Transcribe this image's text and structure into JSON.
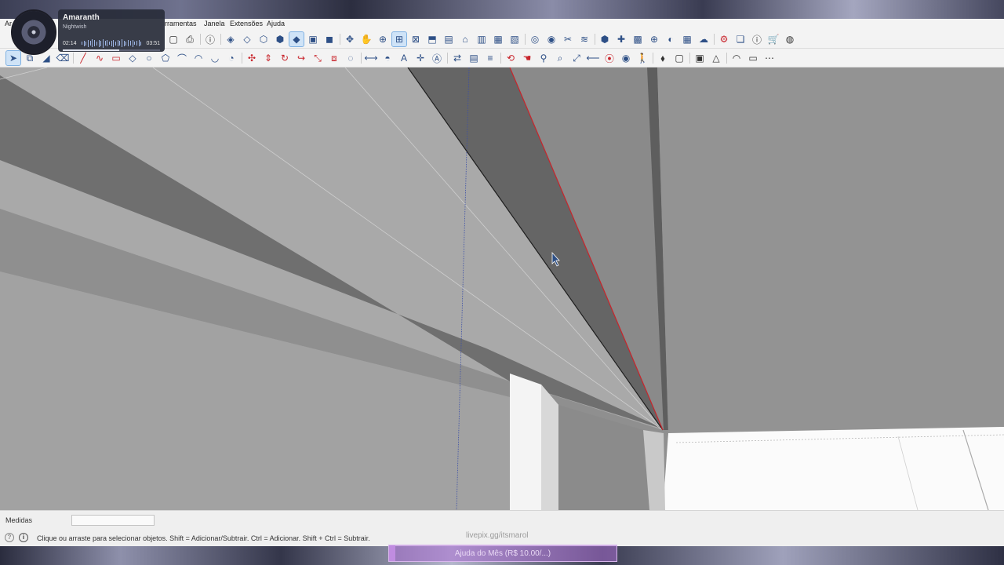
{
  "menu": {
    "items": [
      "Ar",
      "rramentas",
      "Janela",
      "Extensões",
      "Ajuda"
    ]
  },
  "toolbar_row1": {
    "icons": [
      "new-file-icon",
      "print-icon",
      "info-icon",
      "cube-shaded-icon",
      "cube-wire-icon",
      "cube-hidden-icon",
      "cube-xray-icon",
      "cube-solid-icon",
      "cube-texture-icon",
      "cube-mono-icon",
      "orbit-icon",
      "pan-icon",
      "zoom-icon",
      "zoom-window-icon",
      "zoom-extents-icon",
      "iso-view-icon",
      "top-view-icon",
      "front-view-icon",
      "right-view-icon",
      "back-view-icon",
      "left-view-icon",
      "section-plane-icon",
      "section-display-icon",
      "section-cut-icon",
      "section-fill-icon",
      "3d-warehouse-icon",
      "extension-warehouse-icon",
      "layout-icon",
      "add-location-icon",
      "geo-icon",
      "photo-texture-icon",
      "cloud-icon",
      "extension-manager-icon",
      "component-icon",
      "about-icon",
      "store-icon",
      "account-icon"
    ]
  },
  "toolbar_row2": {
    "icons": [
      "select-icon",
      "make-component-icon",
      "paint-icon",
      "eraser-icon",
      "line-icon",
      "freehand-icon",
      "rectangle-icon",
      "rotated-rectangle-icon",
      "circle-icon",
      "polygon-icon",
      "arc-icon",
      "two-point-arc-icon",
      "three-point-arc-icon",
      "pie-icon",
      "move-icon",
      "push-pull-icon",
      "rotate-icon",
      "follow-me-icon",
      "scale-icon",
      "offset-icon",
      "tape-icon",
      "dimension-icon",
      "protractor-icon",
      "text-icon",
      "axes-icon",
      "3d-text-icon",
      "flip-icon",
      "paste-icon",
      "layers-icon",
      "orbit-red-icon",
      "pan-hand-icon",
      "zoom-tool-icon",
      "zoom-window-tool-icon",
      "zoom-extents-tool-icon",
      "previous-view-icon",
      "position-camera-icon",
      "look-around-icon",
      "walk-icon",
      "sandbox-icon",
      "box-icon",
      "solid-box-icon",
      "solid-tools-icon",
      "curve-icon",
      "tag-icon",
      "grid-icon"
    ]
  },
  "music_player": {
    "title": "Amaranth",
    "artist": "Nightwish",
    "elapsed": "02:14",
    "duration": "03:51",
    "progress": 0.58
  },
  "measurements": {
    "label": "Medidas",
    "value": ""
  },
  "status": {
    "hint": "Clique ou arraste para selecionar objetos. Shift = Adicionar/Subtrair. Ctrl = Adicionar. Shift + Ctrl = Subtrair."
  },
  "stream": {
    "link": "livepix.gg/itsmarol",
    "donation": "Ajuda do Mês (R$ 10.00/...)"
  },
  "colors": {
    "accent": "#2d4f86",
    "red_edge": "#c8242b",
    "donation_bar": "#c08ce0"
  }
}
